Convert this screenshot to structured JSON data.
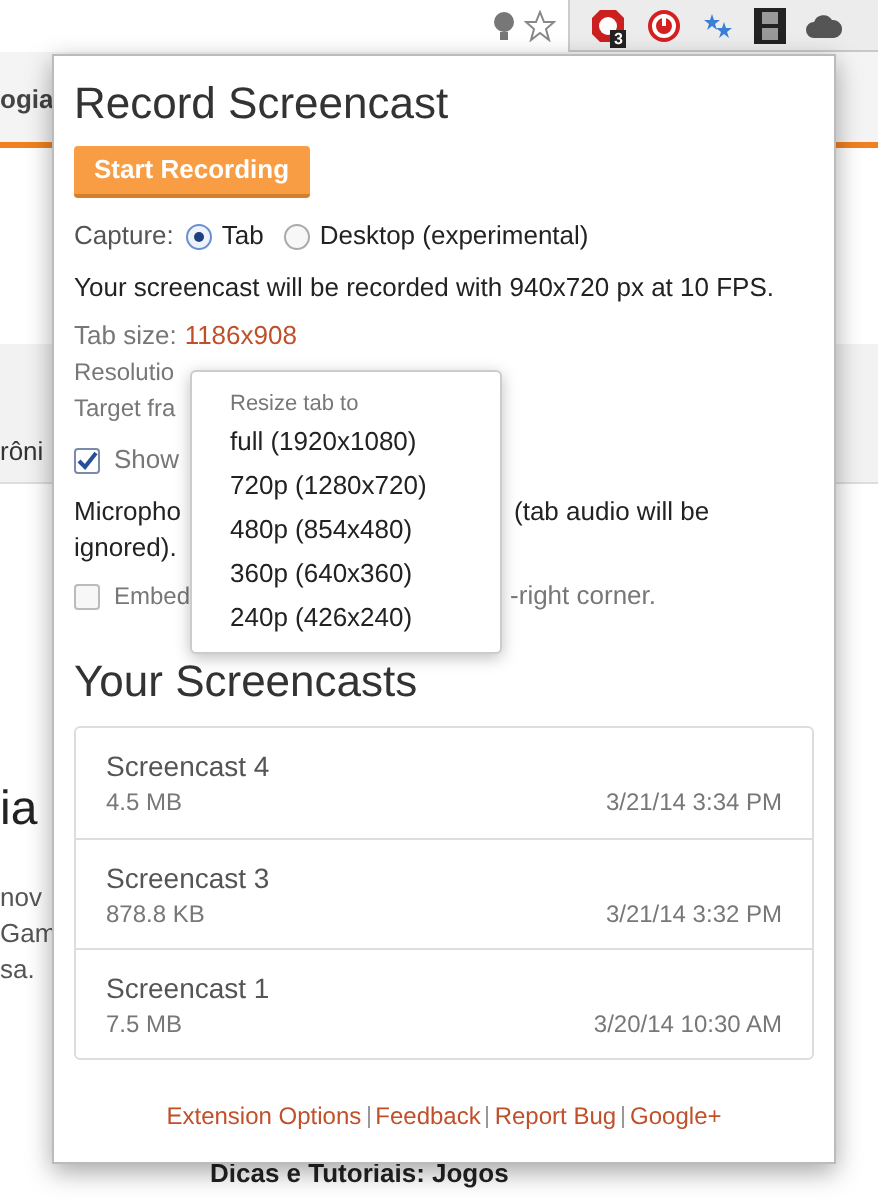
{
  "toolbar": {
    "badge": "3"
  },
  "background_page": {
    "fragments": [
      "ogia",
      "rôni",
      "ia",
      "nov",
      "Gam",
      "sa."
    ],
    "bottom_heading": "Dicas e Tutoriais: Jogos"
  },
  "popup": {
    "title": "Record Screencast",
    "start_button": "Start Recording",
    "capture": {
      "label": "Capture:",
      "options": [
        {
          "label": "Tab",
          "selected": true
        },
        {
          "label": "Desktop (experimental)",
          "selected": false
        }
      ]
    },
    "info": "Your screencast will be recorded with 940x720 px at 10 FPS.",
    "tab_size": {
      "label": "Tab size:",
      "value": "1186x908"
    },
    "resolution_fragment": "Resolutio",
    "target_fragment": "Target fra",
    "show_option": {
      "label": "Show",
      "checked": true
    },
    "microphone": {
      "left": "Micropho",
      "right": "(tab audio will be",
      "second_line": "ignored)."
    },
    "embed_option": {
      "left": "Embed",
      "right": "-right corner.",
      "checked": false
    },
    "resize_menu": {
      "title": "Resize tab to",
      "items": [
        "full (1920x1080)",
        "720p (1280x720)",
        "480p (854x480)",
        "360p (640x360)",
        "240p (426x240)"
      ]
    },
    "screencasts_heading": "Your Screencasts",
    "screencasts": [
      {
        "name": "Screencast 4",
        "size": "4.5 MB",
        "date": "3/21/14 3:34 PM"
      },
      {
        "name": "Screencast 3",
        "size": "878.8 KB",
        "date": "3/21/14 3:32 PM"
      },
      {
        "name": "Screencast 1",
        "size": "7.5 MB",
        "date": "3/20/14 10:30 AM"
      }
    ],
    "footer_links": [
      "Extension Options",
      "Feedback",
      "Report Bug",
      "Google+"
    ]
  }
}
